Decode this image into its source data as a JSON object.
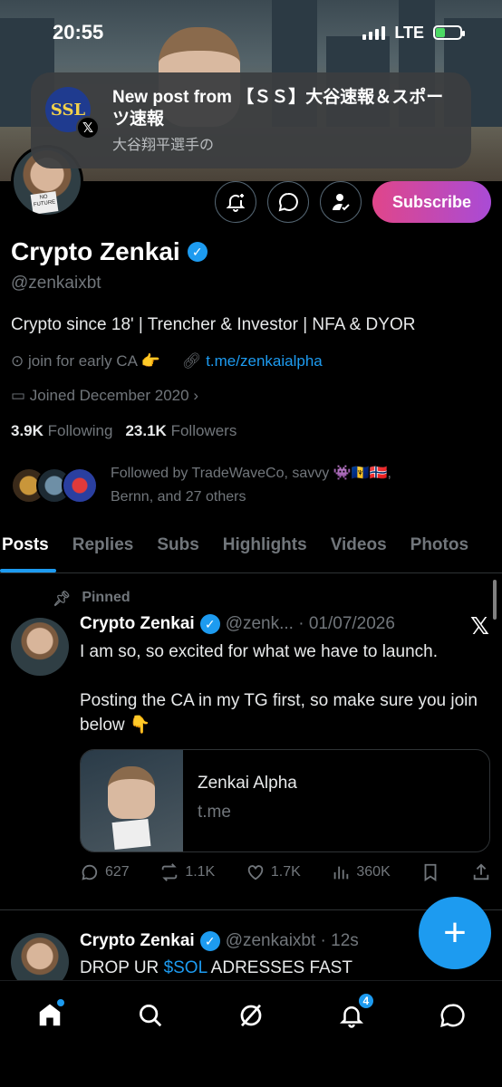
{
  "status": {
    "time": "20:55",
    "network": "LTE"
  },
  "notification": {
    "title": "New post from 【ＳＳ】大谷速報＆スポーツ速報",
    "body": "大谷翔平選手の",
    "app_logo_text": "SSL"
  },
  "profile": {
    "name": "Crypto Zenkai",
    "handle": "@zenkaixbt",
    "bio": "Crypto since 18' | Trencher & Investor | NFA & DYOR",
    "location": "join for early CA 👉",
    "link": "t.me/zenkaialpha",
    "joined": "Joined December 2020",
    "following_count": "3.9K",
    "following_label": "Following",
    "followers_count": "23.1K",
    "followers_label": "Followers",
    "followed_by_line1": "Followed by TradeWaveCo, savvy 👾🇧🇧🇳🇴,",
    "followed_by_line2": "Bernn, and 27 others",
    "subscribe_label": "Subscribe"
  },
  "tabs": [
    "Posts",
    "Replies",
    "Subs",
    "Highlights",
    "Videos",
    "Photos"
  ],
  "pinned_post": {
    "pinned_label": "Pinned",
    "author": "Crypto Zenkai",
    "handle_date": "@zenk... · 01/07/2026",
    "text_line1": "I am so, so excited for what we have to launch.",
    "text_line2": "Posting the CA in my TG first, so make sure you join below 👇",
    "card_title": "Zenkai Alpha",
    "card_url": "t.me",
    "replies": "627",
    "reposts": "1.1K",
    "likes": "1.7K",
    "views": "360K"
  },
  "second_post": {
    "author": "Crypto Zenkai",
    "handle_time": "@zenkaixbt · 12s",
    "text_before": "DROP UR ",
    "text_tag": "$SOL",
    "text_after": " ADRESSES FAST"
  },
  "nav": {
    "notification_count": "4"
  },
  "colors": {
    "accent": "#1d9bf0",
    "background": "#000000",
    "muted": "#71767b"
  }
}
